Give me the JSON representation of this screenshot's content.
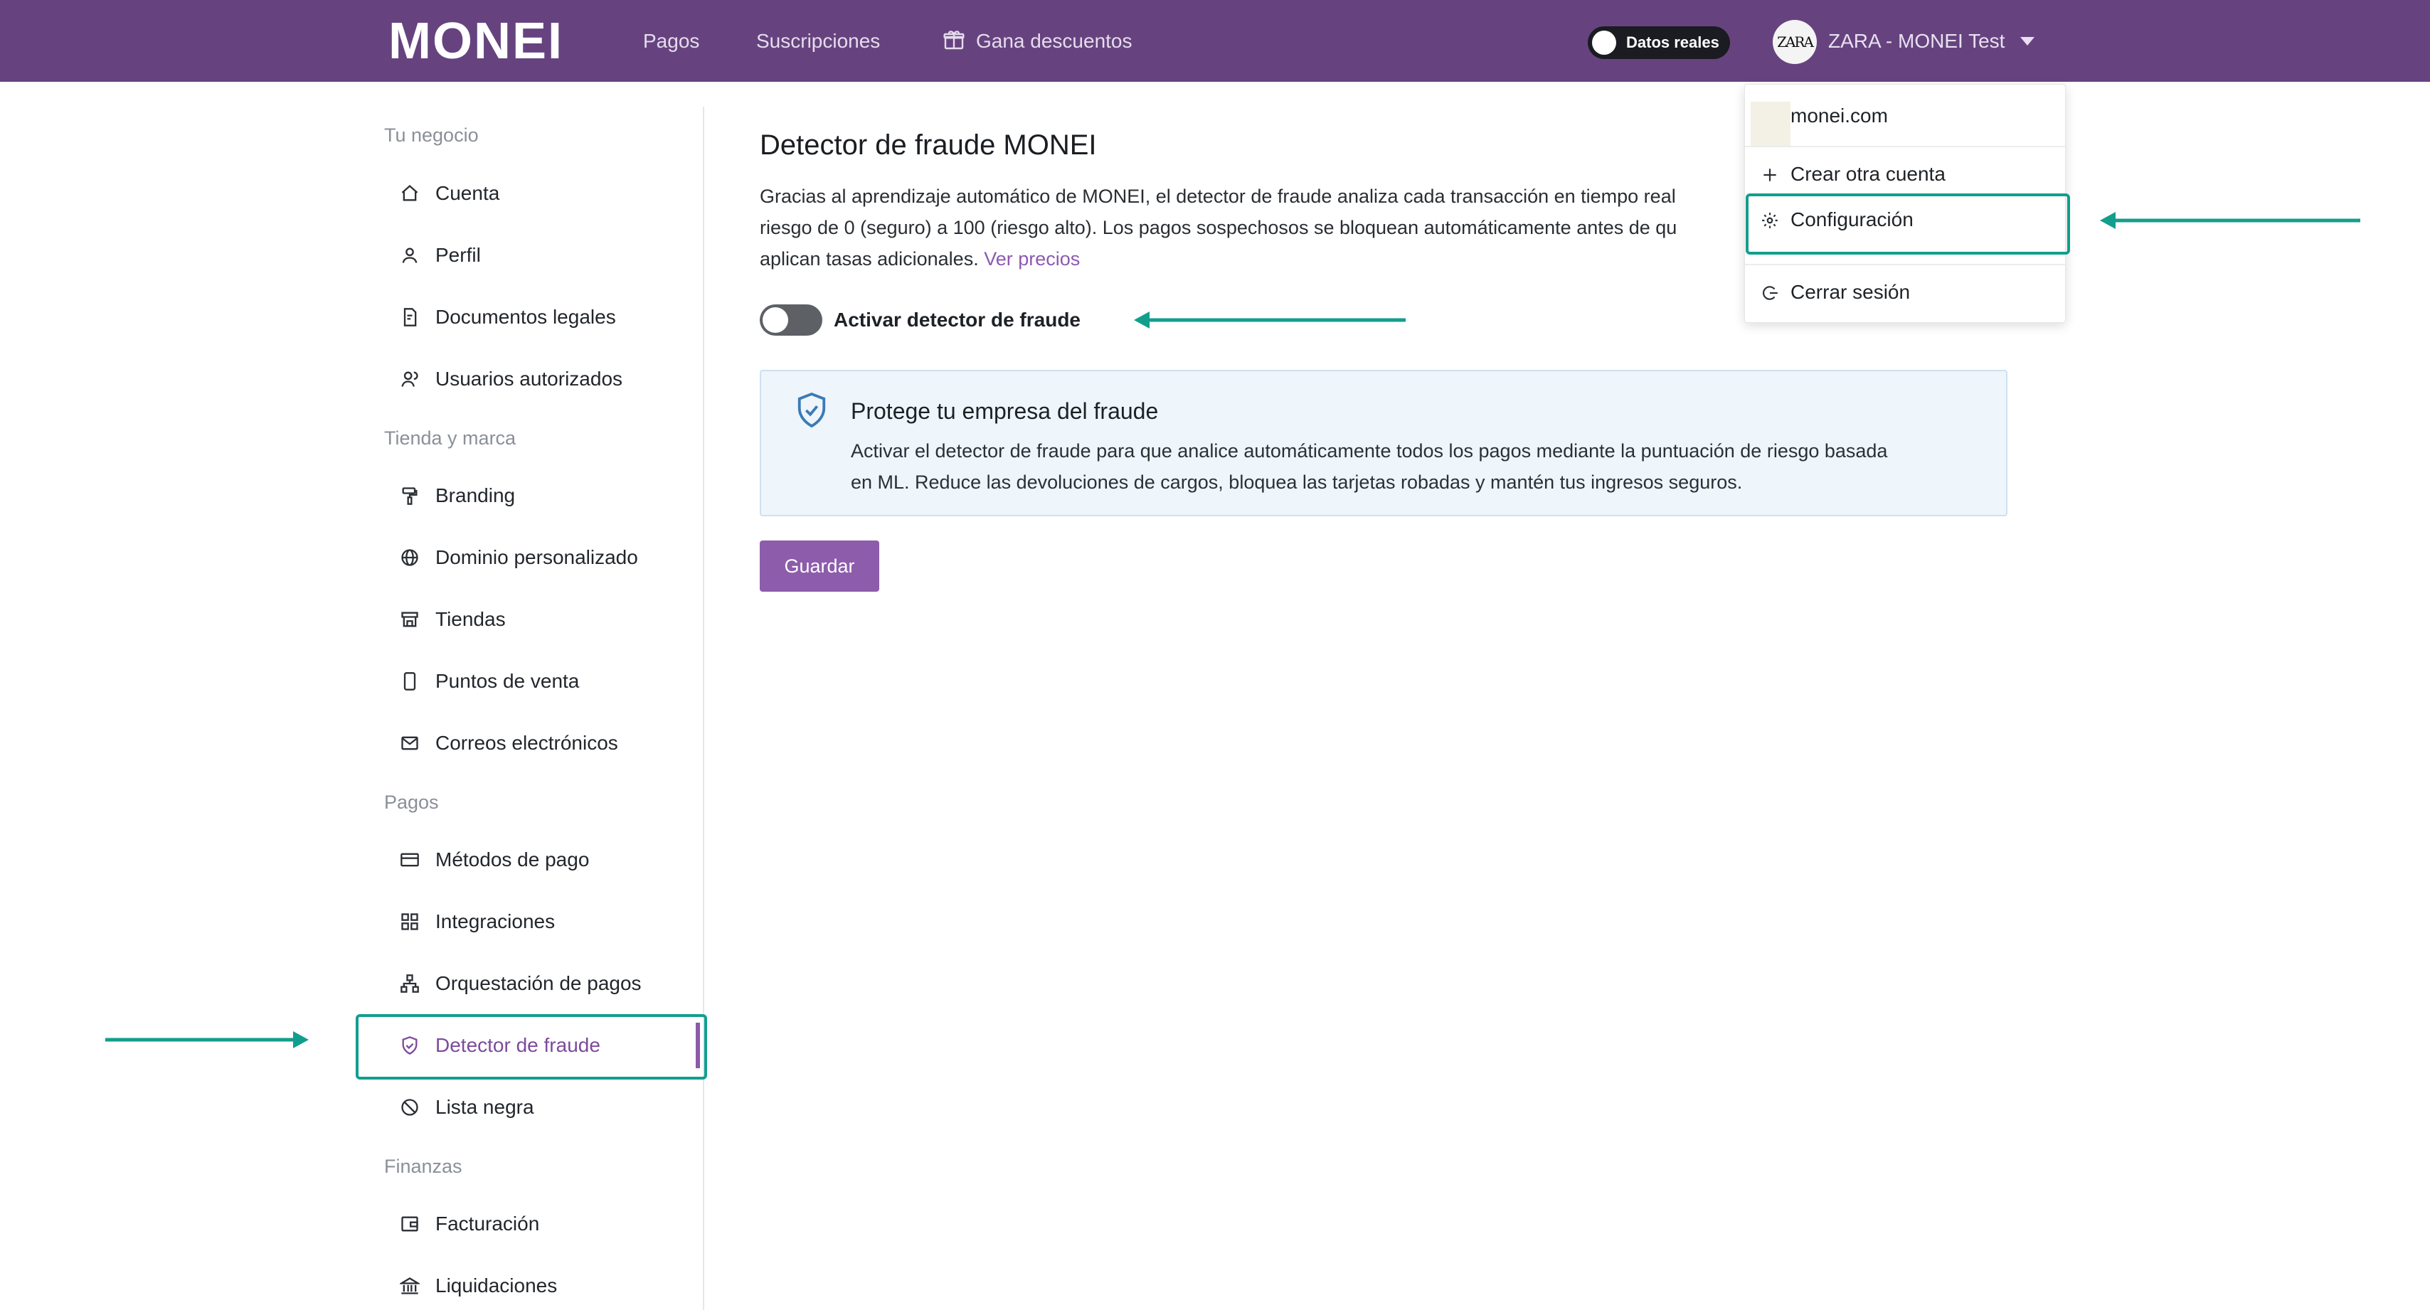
{
  "topbar": {
    "logo": "MONEI",
    "nav": [
      {
        "label": "Pagos"
      },
      {
        "label": "Suscripciones"
      },
      {
        "label": "Gana descuentos",
        "icon": "gift-icon"
      }
    ],
    "live_toggle_label": "Datos reales",
    "avatar_text": "ZARA",
    "account_name": "ZARA - MONEI Test"
  },
  "sidebar": {
    "sections": [
      {
        "title": "Tu negocio",
        "items": [
          {
            "label": "Cuenta",
            "icon": "home-icon"
          },
          {
            "label": "Perfil",
            "icon": "user-icon"
          },
          {
            "label": "Documentos legales",
            "icon": "document-icon"
          },
          {
            "label": "Usuarios autorizados",
            "icon": "users-icon"
          }
        ]
      },
      {
        "title": "Tienda y marca",
        "items": [
          {
            "label": "Branding",
            "icon": "paint-roller-icon"
          },
          {
            "label": "Dominio personalizado",
            "icon": "globe-icon"
          },
          {
            "label": "Tiendas",
            "icon": "store-icon"
          },
          {
            "label": "Puntos de venta",
            "icon": "tablet-icon"
          },
          {
            "label": "Correos electrónicos",
            "icon": "mail-icon"
          }
        ]
      },
      {
        "title": "Pagos",
        "items": [
          {
            "label": "Métodos de pago",
            "icon": "credit-card-icon"
          },
          {
            "label": "Integraciones",
            "icon": "grid-icon"
          },
          {
            "label": "Orquestación de pagos",
            "icon": "sitemap-icon"
          },
          {
            "label": "Detector de fraude",
            "icon": "shield-check-icon",
            "active": true
          },
          {
            "label": "Lista negra",
            "icon": "ban-icon"
          }
        ]
      },
      {
        "title": "Finanzas",
        "items": [
          {
            "label": "Facturación",
            "icon": "wallet-icon"
          },
          {
            "label": "Liquidaciones",
            "icon": "bank-icon"
          }
        ]
      }
    ]
  },
  "main": {
    "title": "Detector de fraude MONEI",
    "description_lines": [
      "Gracias al aprendizaje automático de MONEI, el detector de fraude analiza cada transacción en tiempo real",
      "riesgo de 0 (seguro) a 100 (riesgo alto). Los pagos sospechosos se bloquean automáticamente antes de qu",
      "aplican tasas adicionales."
    ],
    "pricing_link": "Ver precios",
    "toggle_label": "Activar detector de fraude",
    "info": {
      "title": "Protege tu empresa del fraude",
      "lines": [
        "Activar el detector de fraude para que analice automáticamente todos los pagos mediante la puntuación de riesgo basada",
        "en ML. Reduce las devoluciones de cargos, bloquea las tarjetas robadas y mantén tus ingresos seguros."
      ]
    },
    "save_label": "Guardar"
  },
  "dropdown": {
    "items": [
      {
        "label": "monei.com"
      },
      {
        "label": "Crear otra cuenta",
        "icon": "plus-icon"
      },
      {
        "label": "Configuración",
        "icon": "gear-icon"
      },
      {
        "label": "Cerrar sesión",
        "icon": "logout-icon"
      }
    ]
  },
  "colors": {
    "topbar": "#66437f",
    "accent": "#8d5cab",
    "highlight": "#129e8e",
    "info_bg": "#eef5fb"
  }
}
